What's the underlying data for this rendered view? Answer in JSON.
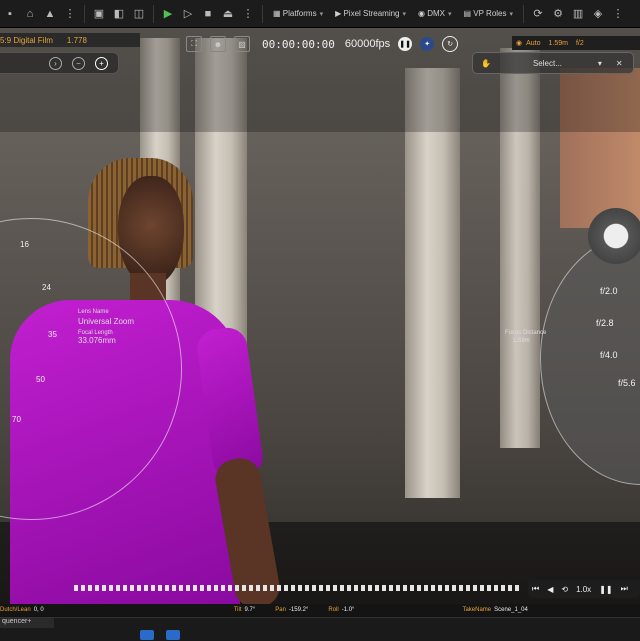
{
  "toolbar": {
    "platforms_label": "Platforms",
    "pixel_streaming_label": "Pixel Streaming",
    "dmx_label": "DMX",
    "vp_roles_label": "VP Roles"
  },
  "filmback": {
    "name": "5:9 Digital Film",
    "ratio": "1.778"
  },
  "viewport": {
    "timecode": "00:00:00:00",
    "fps": "60000fps",
    "select_label": "Select...",
    "info": {
      "exposure_label": "Auto",
      "focus_label": "1.59m",
      "extra": "f/2"
    }
  },
  "lens": {
    "lens_name_label": "Lens Name",
    "lens_name": "Universal Zoom",
    "focal_label": "Focal Length",
    "focal_value": "33.076mm",
    "dial_ticks": [
      "16",
      "24",
      "35",
      "50",
      "70"
    ],
    "focus_distance_label": "Focus Distance",
    "focus_distance_value": "1.59m"
  },
  "aperture": {
    "stops": [
      "f/2.0",
      "f/2.8",
      "f/4.0",
      "f/5.6"
    ]
  },
  "transport": {
    "speed": "1.0x"
  },
  "status": {
    "dutch_label": "Dutch/Lean",
    "dutch_value": "0, 0",
    "tilt_label": "Tilt",
    "tilt_value": "9.7°",
    "pan_label": "Pan",
    "pan_value": "-159.2°",
    "roll_label": "Roll",
    "roll_value": "-1.0°",
    "take_label": "TakeName",
    "take_value": "Scene_1_04"
  },
  "sequencer": {
    "tab_label": "quencer+"
  }
}
